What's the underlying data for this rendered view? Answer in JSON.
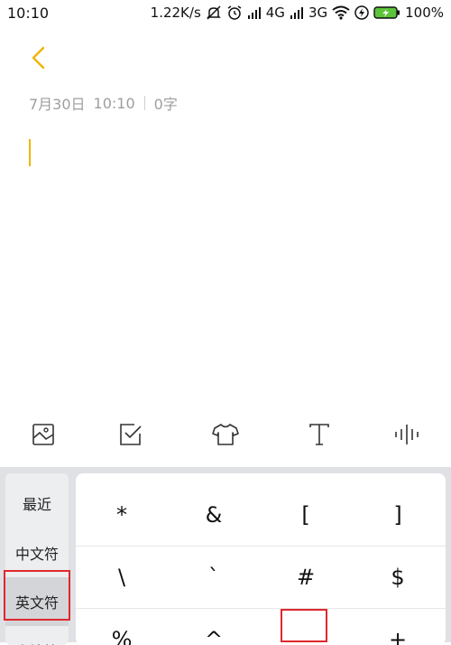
{
  "status_bar": {
    "time": "10:10",
    "speed": "1.22K/s",
    "network_4g": "4G",
    "network_3g": "3G",
    "battery": "100%",
    "icons": [
      "mute-icon",
      "alarm-icon",
      "signal-icon",
      "wifi-icon",
      "charging-icon",
      "battery-icon"
    ]
  },
  "note": {
    "date": "7月30日",
    "time": "10:10",
    "word_count": "0字"
  },
  "toolbar": {
    "icons": [
      "image-icon",
      "checkbox-icon",
      "shirt-icon",
      "text-format-icon",
      "voice-icon"
    ]
  },
  "keyboard": {
    "categories": [
      "最近",
      "中文符",
      "英文符",
      "表情符"
    ],
    "selected_category": "英文符",
    "keys": [
      [
        "*",
        "&",
        "[",
        "]"
      ],
      [
        "\\",
        "`",
        "#",
        "$"
      ],
      [
        "%",
        "^",
        "_",
        "+"
      ]
    ]
  },
  "colors": {
    "accent": "#f0b400",
    "highlight_box": "#e0282e",
    "keyboard_bg": "#dfe1e4"
  }
}
